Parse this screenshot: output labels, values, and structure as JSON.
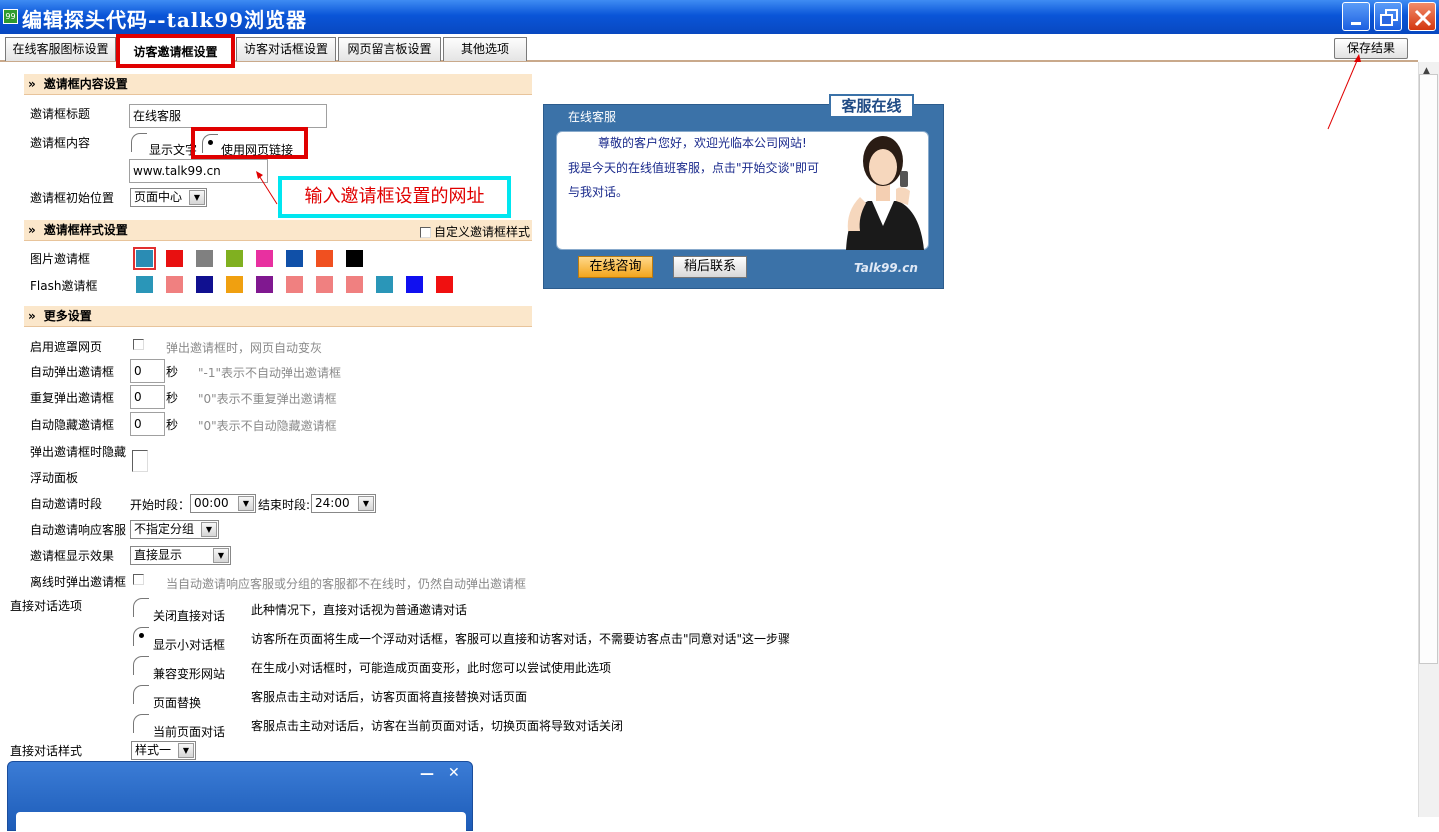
{
  "window": {
    "title": "编辑探头代码--talk99浏览器",
    "icon_text": "99",
    "minimize_icon": "minimize-icon",
    "maximize_icon": "restore-icon",
    "close_icon": "close-icon"
  },
  "tabs": [
    {
      "label": "在线客服图标设置"
    },
    {
      "label": "访客邀请框设置"
    },
    {
      "label": "访客对话框设置"
    },
    {
      "label": "网页留言板设置"
    },
    {
      "label": "其他选项"
    }
  ],
  "active_tab": 1,
  "save_label": "保存结果",
  "sections": {
    "content": "邀请框内容设置",
    "style": "邀请框样式设置",
    "more": "更多设置",
    "arrows": "»"
  },
  "content": {
    "title_label": "邀请框标题",
    "title_value": "在线客服",
    "body_label": "邀请框内容",
    "radio_text": "显示文字",
    "radio_link": "使用网页链接",
    "url_value": "www.talk99.cn",
    "position_label": "邀请框初始位置",
    "position_value": "页面中心"
  },
  "callout": "输入邀请框设置的网址",
  "style": {
    "custom_label": "自定义邀请框样式",
    "image_label": "图片邀请框",
    "flash_label": "Flash邀请框",
    "image_colors": [
      "#2a8cb4",
      "#e81010",
      "#808080",
      "#80b020",
      "#e830a0",
      "#1050a8",
      "#f05020",
      "#000000"
    ],
    "flash_colors": [
      "#2a96b8",
      "#f08080",
      "#101090",
      "#f0a010",
      "#801890",
      "#f08080",
      "#f08080",
      "#f08080",
      "#2a96b8",
      "#1010f0",
      "#f01010"
    ]
  },
  "more": {
    "mask_label": "启用遮罩网页",
    "mask_hint": "弹出邀请框时，网页自动变灰",
    "auto_popup_label": "自动弹出邀请框",
    "auto_popup_value": "0",
    "auto_popup_hint": "\"-1\"表示不自动弹出邀请框",
    "repeat_label": "重复弹出邀请框",
    "repeat_value": "0",
    "repeat_hint": "\"0\"表示不重复弹出邀请框",
    "auto_hide_label": "自动隐藏邀请框",
    "auto_hide_value": "0",
    "auto_hide_hint": "\"0\"表示不自动隐藏邀请框",
    "sec_unit": "秒",
    "hide_panel_label1": "弹出邀请框时隐藏",
    "hide_panel_label2": "浮动面板",
    "period_label": "自动邀请时段",
    "start_label": "开始时段：",
    "start_value": "00:00",
    "end_label": "结束时段:",
    "end_value": "24:00",
    "respond_label": "自动邀请响应客服",
    "respond_value": "不指定分组",
    "effect_label": "邀请框显示效果",
    "effect_value": "直接显示",
    "offline_label": "离线时弹出邀请框",
    "offline_hint": "当自动邀请响应客服或分组的客服都不在线时，仍然自动弹出邀请框"
  },
  "direct": {
    "label": "直接对话选项",
    "options": [
      {
        "label": "关闭直接对话",
        "desc": "此种情况下，直接对话视为普通邀请对话"
      },
      {
        "label": "显示小对话框",
        "desc": "访客所在页面将生成一个浮动对话框，客服可以直接和访客对话，不需要访客点击\"同意对话\"这一步骤"
      },
      {
        "label": "兼容变形网站",
        "desc": "在生成小对话框时，可能造成页面变形，此时您可以尝试使用此选项"
      },
      {
        "label": "页面替换",
        "desc": "客服点击主动对话后，访客页面将直接替换对话页面"
      },
      {
        "label": "当前页面对话",
        "desc": "客服点击主动对话后，访客在当前页面对话，切换页面将导致对话关闭"
      }
    ],
    "selected": 1,
    "style_label": "直接对话样式",
    "style_value": "样式一"
  },
  "preview": {
    "title": "在线客服",
    "badge": "客服在线",
    "line1": "尊敬的客户您好，欢迎光临本公司网站!",
    "line2": "我是今天的在线值班客服，点击\"开始交谈\"即可",
    "line3": "与我对话。",
    "btn_consult": "在线咨询",
    "btn_later": "稍后联系",
    "logo": "Talk99.cn"
  },
  "mini_window": {
    "min_glyph": "—",
    "close_glyph": "✕"
  }
}
